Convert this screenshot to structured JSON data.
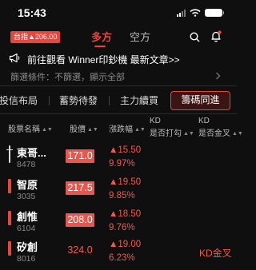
{
  "status_bar": {
    "time": "15:43"
  },
  "header": {
    "index_badge": "台指▲206.00",
    "tabs": [
      {
        "label": "多方",
        "active": true
      },
      {
        "label": "空方",
        "active": false
      }
    ],
    "icons": [
      "search-icon",
      "bell-icon"
    ]
  },
  "banner": {
    "text": "前往觀看 Winner印鈔機 最新文章>>",
    "icon": "megaphone-icon"
  },
  "filter": {
    "text": "篩選條件：不篩選，顯示全部"
  },
  "category_tabs": [
    {
      "label": "投信布局",
      "active": false
    },
    {
      "label": "蓄勢待發",
      "active": false
    },
    {
      "label": "主力續買",
      "active": false
    },
    {
      "label": "籌碼同進",
      "active": true
    }
  ],
  "table": {
    "headers": {
      "name": "股票名稱",
      "price": "股價",
      "change": "漲跌幅",
      "kd_cross_up_1": "KD",
      "kd_cross_up_2": "是否打勾",
      "kd_golden_1": "KD",
      "kd_golden_2": "是否金叉"
    },
    "rows": [
      {
        "name": "東哥...",
        "code": "8478",
        "price": "171.0",
        "change": "▲15.50",
        "pct": "9.97%",
        "kd": "",
        "price_highlight": true,
        "marker": "line"
      },
      {
        "name": "智原",
        "code": "3035",
        "price": "217.5",
        "change": "▲19.50",
        "pct": "9.85%",
        "kd": "",
        "price_highlight": true,
        "marker": "bar"
      },
      {
        "name": "創惟",
        "code": "6104",
        "price": "208.0",
        "change": "▲18.50",
        "pct": "9.76%",
        "kd": "",
        "price_highlight": true,
        "marker": "bar"
      },
      {
        "name": "矽創",
        "code": "8016",
        "price": "324.0",
        "change": "▲19.00",
        "pct": "6.23%",
        "kd": "KD金叉",
        "price_highlight": false,
        "marker": "bar"
      }
    ]
  },
  "colors": {
    "accent": "#e8453c",
    "up": "#f05a50",
    "background": "#0f0f0f"
  }
}
